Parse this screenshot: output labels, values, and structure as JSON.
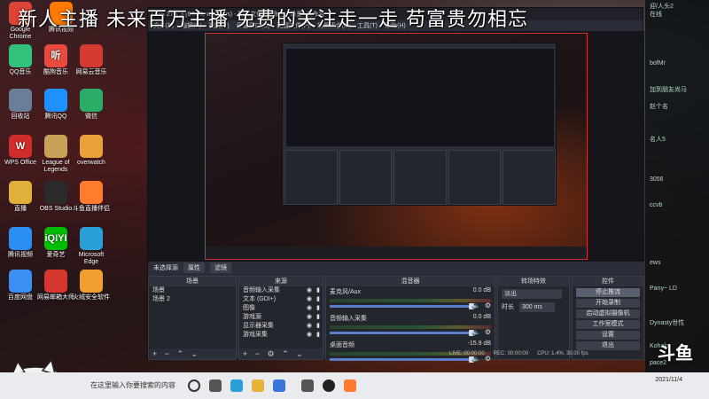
{
  "marquee": "新人主播 未来百万主播 免费的关注走一走 苟富贵勿相忘",
  "desktop_icons": [
    {
      "label": "Google Chrome",
      "glyph": "",
      "color": "#db4437"
    },
    {
      "label": "腾讯视频",
      "glyph": "",
      "color": "#ff7a00"
    },
    {
      "label": "QQ音乐",
      "glyph": "",
      "color": "#31c27c"
    },
    {
      "label": "酷狗音乐",
      "glyph": "听",
      "color": "#e94a3f"
    },
    {
      "label": "网易云音乐",
      "glyph": "",
      "color": "#d33a31"
    },
    {
      "label": "回收站",
      "glyph": "",
      "color": "#6a7e98"
    },
    {
      "label": "腾讯QQ",
      "glyph": "",
      "color": "#1e90ff"
    },
    {
      "label": "微信",
      "glyph": "",
      "color": "#2aae67"
    },
    {
      "label": "WPS Office",
      "glyph": "W",
      "color": "#d12c2c"
    },
    {
      "label": "League of Legends",
      "glyph": "",
      "color": "#c7a258"
    },
    {
      "label": "overwatch",
      "glyph": "",
      "color": "#e9a23b"
    },
    {
      "label": "直播",
      "glyph": "",
      "color": "#e0b03a"
    },
    {
      "label": "OBS Studio",
      "glyph": "",
      "color": "#2b2b2b"
    },
    {
      "label": "斗鱼直播伴侣",
      "glyph": "",
      "color": "#ff7b2e"
    },
    {
      "label": "腾讯视频",
      "glyph": "",
      "color": "#2a8ef2"
    },
    {
      "label": "爱奇艺",
      "glyph": "iQIYI",
      "color": "#00be06"
    },
    {
      "label": "Microsoft Edge",
      "glyph": "",
      "color": "#2b9fd8"
    },
    {
      "label": "百度网盘",
      "glyph": "",
      "color": "#3c8ff5"
    },
    {
      "label": "网易邮箱大师",
      "glyph": "",
      "color": "#d5362e"
    },
    {
      "label": "火绒安全软件",
      "glyph": "",
      "color": "#f0a030"
    }
  ],
  "chat_lines": [
    "迎/人头2",
    "在线",
    "",
    "",
    "",
    "",
    "",
    "bofMr",
    "",
    "",
    "加到朋友尚马",
    "",
    "赵个名",
    "",
    "",
    "",
    "名人5",
    "",
    "",
    "",
    "",
    "3056",
    "",
    "",
    "ccvb",
    "",
    "",
    "",
    "",
    "",
    "",
    "ews",
    "",
    "",
    "Pany~ LD",
    "",
    "",
    "",
    "Dynasty世性",
    "",
    "",
    "Kohaku",
    "",
    "pace2"
  ],
  "obs": {
    "title": "OBS 27.1.3 (64-bit, windows) - 配置文件: 未命名 - 场景: 未命名",
    "menu": [
      "文件(F)",
      "编辑(E)",
      "视图(V)",
      "停靠窗口(D)",
      "配置文件(P)",
      "场景集合(S)",
      "工具(T)",
      "帮助(H)"
    ],
    "scene_bar": {
      "title": "未选择源",
      "buttons": [
        "属性",
        "滤镜"
      ]
    },
    "scenes": {
      "header": "场景",
      "items": [
        "场景",
        "场景 2"
      ],
      "foot": "+ − ⌃ ⌄"
    },
    "sources": {
      "header": "来源",
      "items": [
        "音频输入采集",
        "文本 (GDI+)",
        "图像",
        "游戏源",
        "显示器采集",
        "游戏采集"
      ],
      "foot": "+ − ⚙ ⌃ ⌄"
    },
    "mixer": {
      "header": "混音器",
      "channels": [
        {
          "name": "麦克风/Aux",
          "db": "0.0 dB",
          "muted": true
        },
        {
          "name": "音频输入采集",
          "db": "0.0 dB",
          "muted": false
        },
        {
          "name": "桌面音频",
          "db": "-15.9 dB",
          "muted": false
        }
      ]
    },
    "transitions": {
      "header": "转场特效",
      "selected": "淡出",
      "duration_label": "时长",
      "duration": "300 ms"
    },
    "controls": {
      "header": "控件",
      "buttons": [
        "停止推流",
        "开始录制",
        "启动虚拟摄像机",
        "工作室模式",
        "设置",
        "退出"
      ]
    },
    "status": {
      "live": "LIVE: 00:00:00",
      "rec": "REC: 00:00:00",
      "cpu": "CPU: 1.4%, 30.00 fps"
    }
  },
  "taskbar": {
    "search_placeholder": "在这里输入你要搜索的内容",
    "time": "",
    "date": "2021/11/4"
  },
  "logo": "斗鱼"
}
